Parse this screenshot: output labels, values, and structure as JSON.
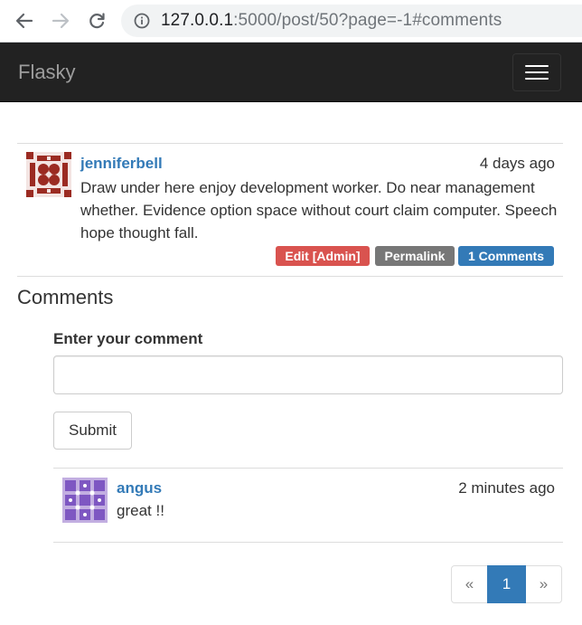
{
  "browser": {
    "url_host": "127.0.0.1",
    "url_rest": ":5000/post/50?page=-1#comments"
  },
  "navbar": {
    "brand": "Flasky"
  },
  "post": {
    "author": "jenniferbell",
    "date": "4 days ago",
    "body": "Draw under here enjoy development worker. Do near management whether. Evidence option space without court claim computer. Speech hope thought fall.",
    "labels": {
      "edit": "Edit [Admin]",
      "permalink": "Permalink",
      "comments": "1 Comments"
    }
  },
  "comments_section": {
    "title": "Comments",
    "form_label": "Enter your comment",
    "input_value": "",
    "submit_label": "Submit"
  },
  "comments": [
    {
      "author": "angus",
      "date": "2 minutes ago",
      "body": "great !!"
    }
  ],
  "pagination": {
    "prev": "«",
    "current": "1",
    "next": "»"
  },
  "colors": {
    "link": "#337ab7",
    "danger": "#d9534f",
    "default_label": "#777777",
    "navbar_bg": "#222222",
    "post_avatar": "#9b2b22",
    "comment_avatar": "#7e57c2"
  },
  "icons": {
    "back": "arrow-left-icon",
    "forward": "arrow-right-icon",
    "reload": "reload-icon",
    "site_info": "info-icon",
    "menu": "hamburger-icon"
  }
}
